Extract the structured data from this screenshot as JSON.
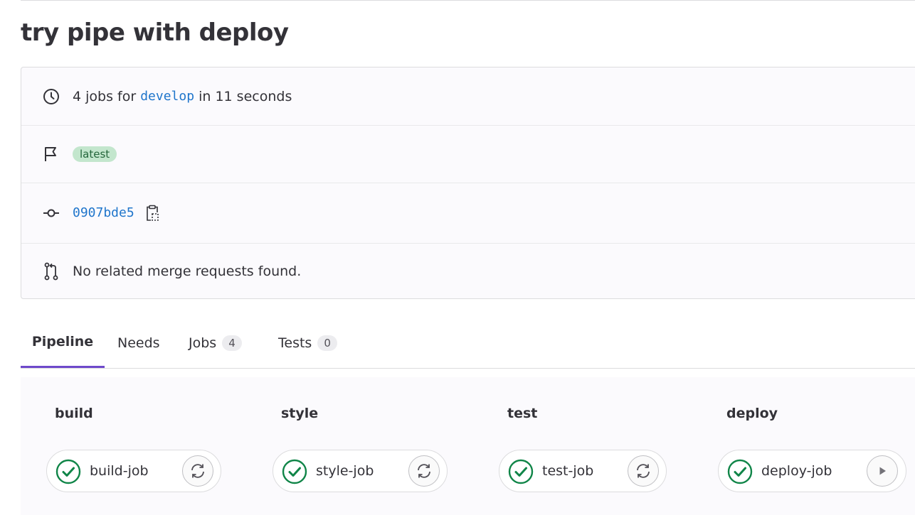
{
  "page": {
    "title": "try pipe with deploy"
  },
  "summary": {
    "jobs_prefix": "4 jobs for",
    "branch": "develop",
    "duration_text": "in 11 seconds",
    "badge": "latest",
    "commit_sha": "0907bde5",
    "merge_requests_text": "No related merge requests found."
  },
  "tabs": [
    {
      "label": "Pipeline",
      "count": null,
      "active": true
    },
    {
      "label": "Needs",
      "count": null,
      "active": false
    },
    {
      "label": "Jobs",
      "count": "4",
      "active": false
    },
    {
      "label": "Tests",
      "count": "0",
      "active": false
    }
  ],
  "stages": [
    {
      "name": "build",
      "job": "build-job",
      "status": "passed",
      "status_icon": "check-circle-icon",
      "action_icon": "retry-icon"
    },
    {
      "name": "style",
      "job": "style-job",
      "status": "passed",
      "status_icon": "check-circle-icon",
      "action_icon": "retry-icon"
    },
    {
      "name": "test",
      "job": "test-job",
      "status": "passed",
      "status_icon": "check-circle-icon",
      "action_icon": "retry-icon"
    },
    {
      "name": "deploy",
      "job": "deploy-job",
      "status": "passed",
      "status_icon": "check-circle-icon",
      "action_icon": "play-icon"
    }
  ],
  "colors": {
    "success": "#108548",
    "link": "#1f75cb",
    "active_tab": "#6e49cb",
    "badge_bg": "#c3e6cd",
    "badge_text": "#24663b"
  }
}
